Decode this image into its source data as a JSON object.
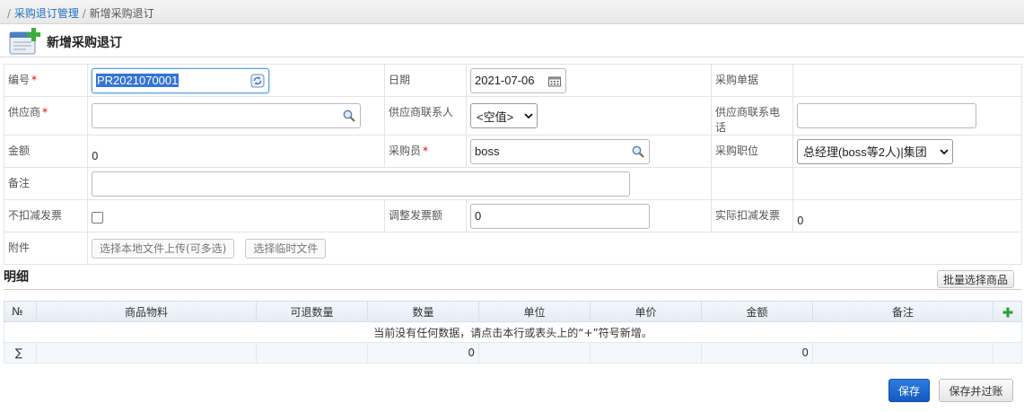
{
  "breadcrumb": {
    "sep1": "/",
    "parent": "采购退订管理",
    "sep2": "/",
    "current": "新增采购退订"
  },
  "title": "新增采购退订",
  "form": {
    "code_label": "编号",
    "code_value": "PR2021070001",
    "date_label": "日期",
    "date_value": "2021-07-06",
    "order_label": "采购单据",
    "supplier_label": "供应商",
    "supplier_value": "",
    "contact_label": "供应商联系人",
    "contact_value": "<空值>",
    "phone_label": "供应商联系电话",
    "phone_value": "",
    "amount_label": "金额",
    "amount_value": "0",
    "buyer_label": "采购员",
    "buyer_value": "boss",
    "position_label": "采购职位",
    "position_value": "总经理(boss等2人)|集团",
    "remark_label": "备注",
    "remark_value": "",
    "no_deduct_label": "不扣减发票",
    "no_deduct_checked": false,
    "adjust_label": "调整发票额",
    "adjust_value": "0",
    "actual_label": "实际扣减发票",
    "actual_value": "0",
    "attach_label": "附件",
    "upload_local": "选择本地文件上传(可多选)",
    "upload_temp": "选择临时文件"
  },
  "detail": {
    "section_title": "明细",
    "batch_button": "批量选择商品",
    "columns": [
      "№",
      "商品物料",
      "可退数量",
      "数量",
      "单位",
      "单价",
      "金额",
      "备注"
    ],
    "empty_message": "当前没有任何数据，请点击本行或表头上的“+”符号新增。",
    "sum_symbol": "∑",
    "sum_qty": "0",
    "sum_amount": "0"
  },
  "buttons": {
    "save": "保存",
    "save_post": "保存并过账"
  },
  "colors": {
    "primary": "#1e6fbf",
    "required": "#ee0000",
    "save_button": "#1a64cc"
  },
  "icons": [
    "new-document-icon",
    "refresh-icon",
    "calendar-icon",
    "search-icon",
    "add-icon",
    "chevron-down-icon"
  ]
}
